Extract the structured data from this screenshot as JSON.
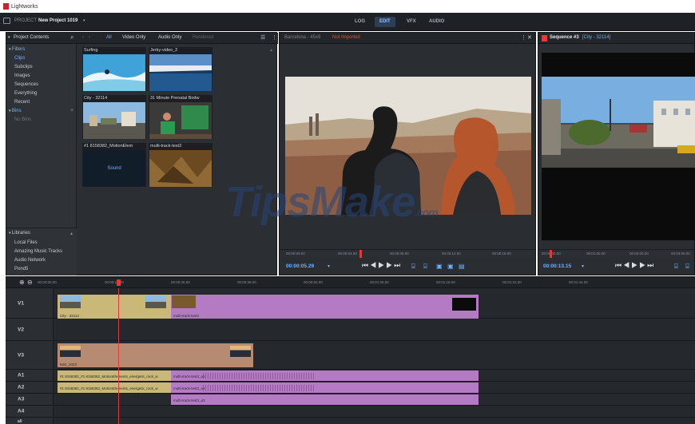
{
  "app": {
    "title": "Lightworks"
  },
  "topbar": {
    "project_label": "PROJECT",
    "project_name": "New Project 1019",
    "tabs": [
      "LOG",
      "EDIT",
      "VFX",
      "AUDIO"
    ],
    "active_tab": "EDIT"
  },
  "project_panel": {
    "title": "Project Contents",
    "filters": {
      "all": "All",
      "video_only": "Video Only",
      "audio_only": "Audio Only",
      "rendered": "Rendered"
    },
    "filters_head": "Filters",
    "nav_items": [
      "Clips",
      "Subclips",
      "Images",
      "Sequences",
      "Everything",
      "Recent"
    ],
    "bins_head": "Bins",
    "no_bins": "No Bins",
    "tiles": [
      {
        "label": "Surfing",
        "thumb": "surfing"
      },
      {
        "label": "Jerky-video_2",
        "thumb": "lake"
      },
      {
        "label": "City - 32114",
        "thumb": "city"
      },
      {
        "label": "31 Minute Prenatal Bodw",
        "thumb": "yoga"
      },
      {
        "label": "#1 8158382_MotionElem",
        "thumb": "sound",
        "inner": "Sound"
      },
      {
        "label": "multi-track-test3",
        "thumb": "texture"
      }
    ],
    "libraries_head": "Libraries",
    "libraries": [
      "Local Files",
      "Amazing Music Tracks",
      "Audio Network",
      "Pond5"
    ]
  },
  "source_viewer": {
    "title": "Barcelona - 45x9",
    "flag": "Not Imported",
    "ruler": [
      "00:00:00.00",
      "00:00:04.00",
      "00:00:08.00",
      "00:00:12.00",
      "00:00:16.00"
    ],
    "timecode": "00:00:05.29"
  },
  "record_viewer": {
    "title": "Sequence #3",
    "sub": "[City - 32114]",
    "ruler": [
      "00:00:00.00",
      "00:01:00.00",
      "00:02:00.00",
      "00:03:00.00"
    ],
    "timecode": "00:00:13.15"
  },
  "timeline": {
    "ruler": [
      "00:00:00.00",
      "00:00:13.00",
      "00:00:26.00",
      "00:00:39.00",
      "00:00:52.00",
      "00:01:05.00",
      "00:01:18.00",
      "00:01:31.00",
      "00:01:44.00"
    ],
    "tracks": [
      "V1",
      "V2",
      "V3",
      "A1",
      "A2",
      "A3",
      "A4"
    ],
    "all_label": "all",
    "clips": {
      "v1a": "City - 32114",
      "v1b": "multi-track-test3",
      "v3a": "IMG_2023",
      "a1a": "#1 8158382_#1 8158382_MotionElements_energetic_rock_w",
      "a1b": "multi-track-test3_a1",
      "a2a": "#1 8158382_#1 8158382_MotionElements_energetic_rock_w",
      "a2b": "multi-track-test3_a2",
      "a3b": "multi-track-test3_a3"
    }
  },
  "watermark": {
    "text": "TipsMake",
    ".com": ".com"
  },
  "colors": {
    "accent": "#6fb3ff",
    "video_clip": "#c9b877",
    "pink_clip": "#b57ac4",
    "brown_clip": "#b78a72",
    "playhead": "#e23a3a"
  }
}
